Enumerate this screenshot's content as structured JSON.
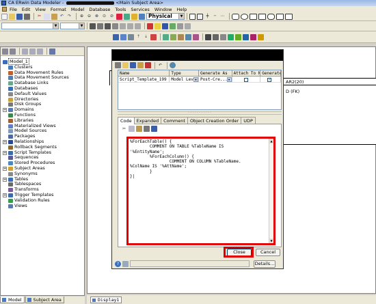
{
  "window": {
    "app_title_prefix": "CA ERwin Data Modeler - ",
    "doc_title": "<Main Subject Area>"
  },
  "menu": [
    "File",
    "Edit",
    "View",
    "Format",
    "Model",
    "Database",
    "Tools",
    "Services",
    "Window",
    "Help"
  ],
  "toolbar": {
    "model_type": "Physical"
  },
  "model_tree": {
    "root": "Model_1",
    "items": [
      {
        "label": "Clusters",
        "expander": ""
      },
      {
        "label": "Data Movement Rules",
        "expander": ""
      },
      {
        "label": "Data Movement Sources",
        "expander": ""
      },
      {
        "label": "Database Links",
        "expander": ""
      },
      {
        "label": "Databases",
        "expander": ""
      },
      {
        "label": "Default Values",
        "expander": ""
      },
      {
        "label": "Directories",
        "expander": ""
      },
      {
        "label": "Disk Groups",
        "expander": ""
      },
      {
        "label": "Domains",
        "expander": "+"
      },
      {
        "label": "Functions",
        "expander": ""
      },
      {
        "label": "Libraries",
        "expander": ""
      },
      {
        "label": "Materialized Views",
        "expander": ""
      },
      {
        "label": "Model Sources",
        "expander": ""
      },
      {
        "label": "Packages",
        "expander": ""
      },
      {
        "label": "Relationships",
        "expander": "+"
      },
      {
        "label": "Rollback Segments",
        "expander": ""
      },
      {
        "label": "Script Templates",
        "expander": "+"
      },
      {
        "label": "Sequences",
        "expander": ""
      },
      {
        "label": "Stored Procedures",
        "expander": ""
      },
      {
        "label": "Subject Areas",
        "expander": "+"
      },
      {
        "label": "Synonyms",
        "expander": ""
      },
      {
        "label": "Tables",
        "expander": "+"
      },
      {
        "label": "Tablespaces",
        "expander": ""
      },
      {
        "label": "Transforms",
        "expander": ""
      },
      {
        "label": "Trigger Templates",
        "expander": "+"
      },
      {
        "label": "Validation Rules",
        "expander": ""
      },
      {
        "label": "Views",
        "expander": ""
      }
    ]
  },
  "bottom_tabs": {
    "model": "Model",
    "subject_area": "Subject Area"
  },
  "canvas": {
    "entity_line1": "AR2(20)",
    "entity_line2": "D (FK)",
    "diagram_tab": "Display1"
  },
  "dialog": {
    "grid": {
      "columns": [
        "Name",
        "Type",
        "Generate As",
        "Attach To New",
        "Generate"
      ],
      "rows": [
        {
          "name": "Script_Template_199",
          "type": "Model Level",
          "generate_as": "Post-Cre...",
          "attach_to_new": "",
          "generate": "✓"
        }
      ]
    },
    "tabs": [
      "Code",
      "Expanded",
      "Comment",
      "Object Creation Order",
      "UDP"
    ],
    "active_tab": "Code",
    "code": "%ForEachTable() {\n        COMMENT ON TABLE %TableName IS\n'%EntityName';\n        %ForEachColumn() {\n                COMMENT ON COLUMN %TableName.\n%ColName IS '%AttName';\n        }\n}|",
    "buttons": {
      "close": "Close",
      "cancel": "Cancel",
      "details": "Details..."
    }
  }
}
